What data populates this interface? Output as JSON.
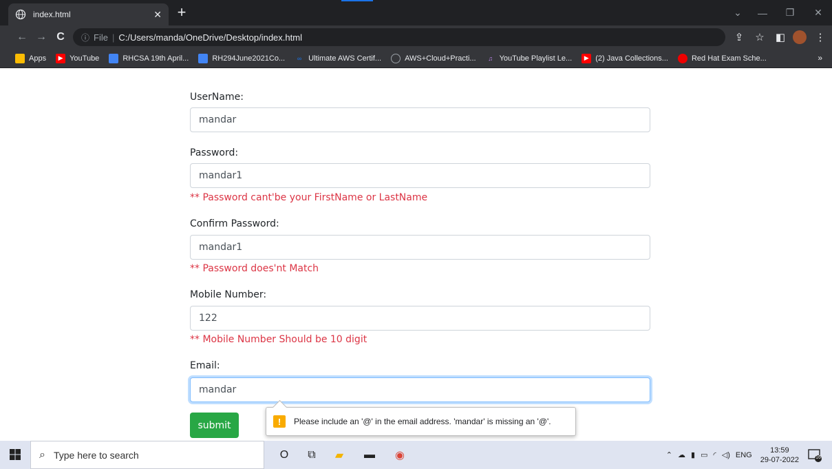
{
  "browser": {
    "tab_title": "index.html",
    "new_tab": "+",
    "url_info": "ⓘ",
    "url_file_label": "File",
    "url": "C:/Users/manda/OneDrive/Desktop/index.html",
    "bookmarks": [
      {
        "label": "Apps",
        "color": "#ea4335"
      },
      {
        "label": "YouTube",
        "color": "#ff0000"
      },
      {
        "label": "RHCSA 19th April...",
        "color": "#4285f4"
      },
      {
        "label": "RH294June2021Co...",
        "color": "#4285f4"
      },
      {
        "label": "Ultimate AWS Certif...",
        "color": "#1a73e8"
      },
      {
        "label": "AWS+Cloud+Practi...",
        "color": "#9aa0a6"
      },
      {
        "label": "YouTube Playlist Le...",
        "color": "#c58af9"
      },
      {
        "label": "(2) Java Collections...",
        "color": "#ff0000"
      },
      {
        "label": "Red Hat Exam Sche...",
        "color": "#ee0000"
      }
    ],
    "bookmarks_more": "»"
  },
  "form": {
    "username_label": "UserName:",
    "username_value": "mandar",
    "password_label": "Password:",
    "password_value": "mandar1",
    "password_error": "** Password cant'be your FirstName or LastName",
    "confirm_label": "Confirm Password:",
    "confirm_value": "mandar1",
    "confirm_error": "** Password does'nt Match",
    "mobile_label": "Mobile Number:",
    "mobile_value": "122",
    "mobile_error": "** Mobile Number Should be 10 digit",
    "email_label": "Email:",
    "email_value": "mandar",
    "submit_label": "submit",
    "validation_message": "Please include an '@' in the email address. 'mandar' is missing an '@'.",
    "warn_glyph": "!"
  },
  "taskbar": {
    "search_placeholder": "Type here to search",
    "language": "ENG",
    "time": "13:59",
    "date": "29-07-2022",
    "notification_count": "16"
  },
  "colors": {
    "error": "#dc3545",
    "submit": "#28a745",
    "focus": "#80bdff"
  }
}
